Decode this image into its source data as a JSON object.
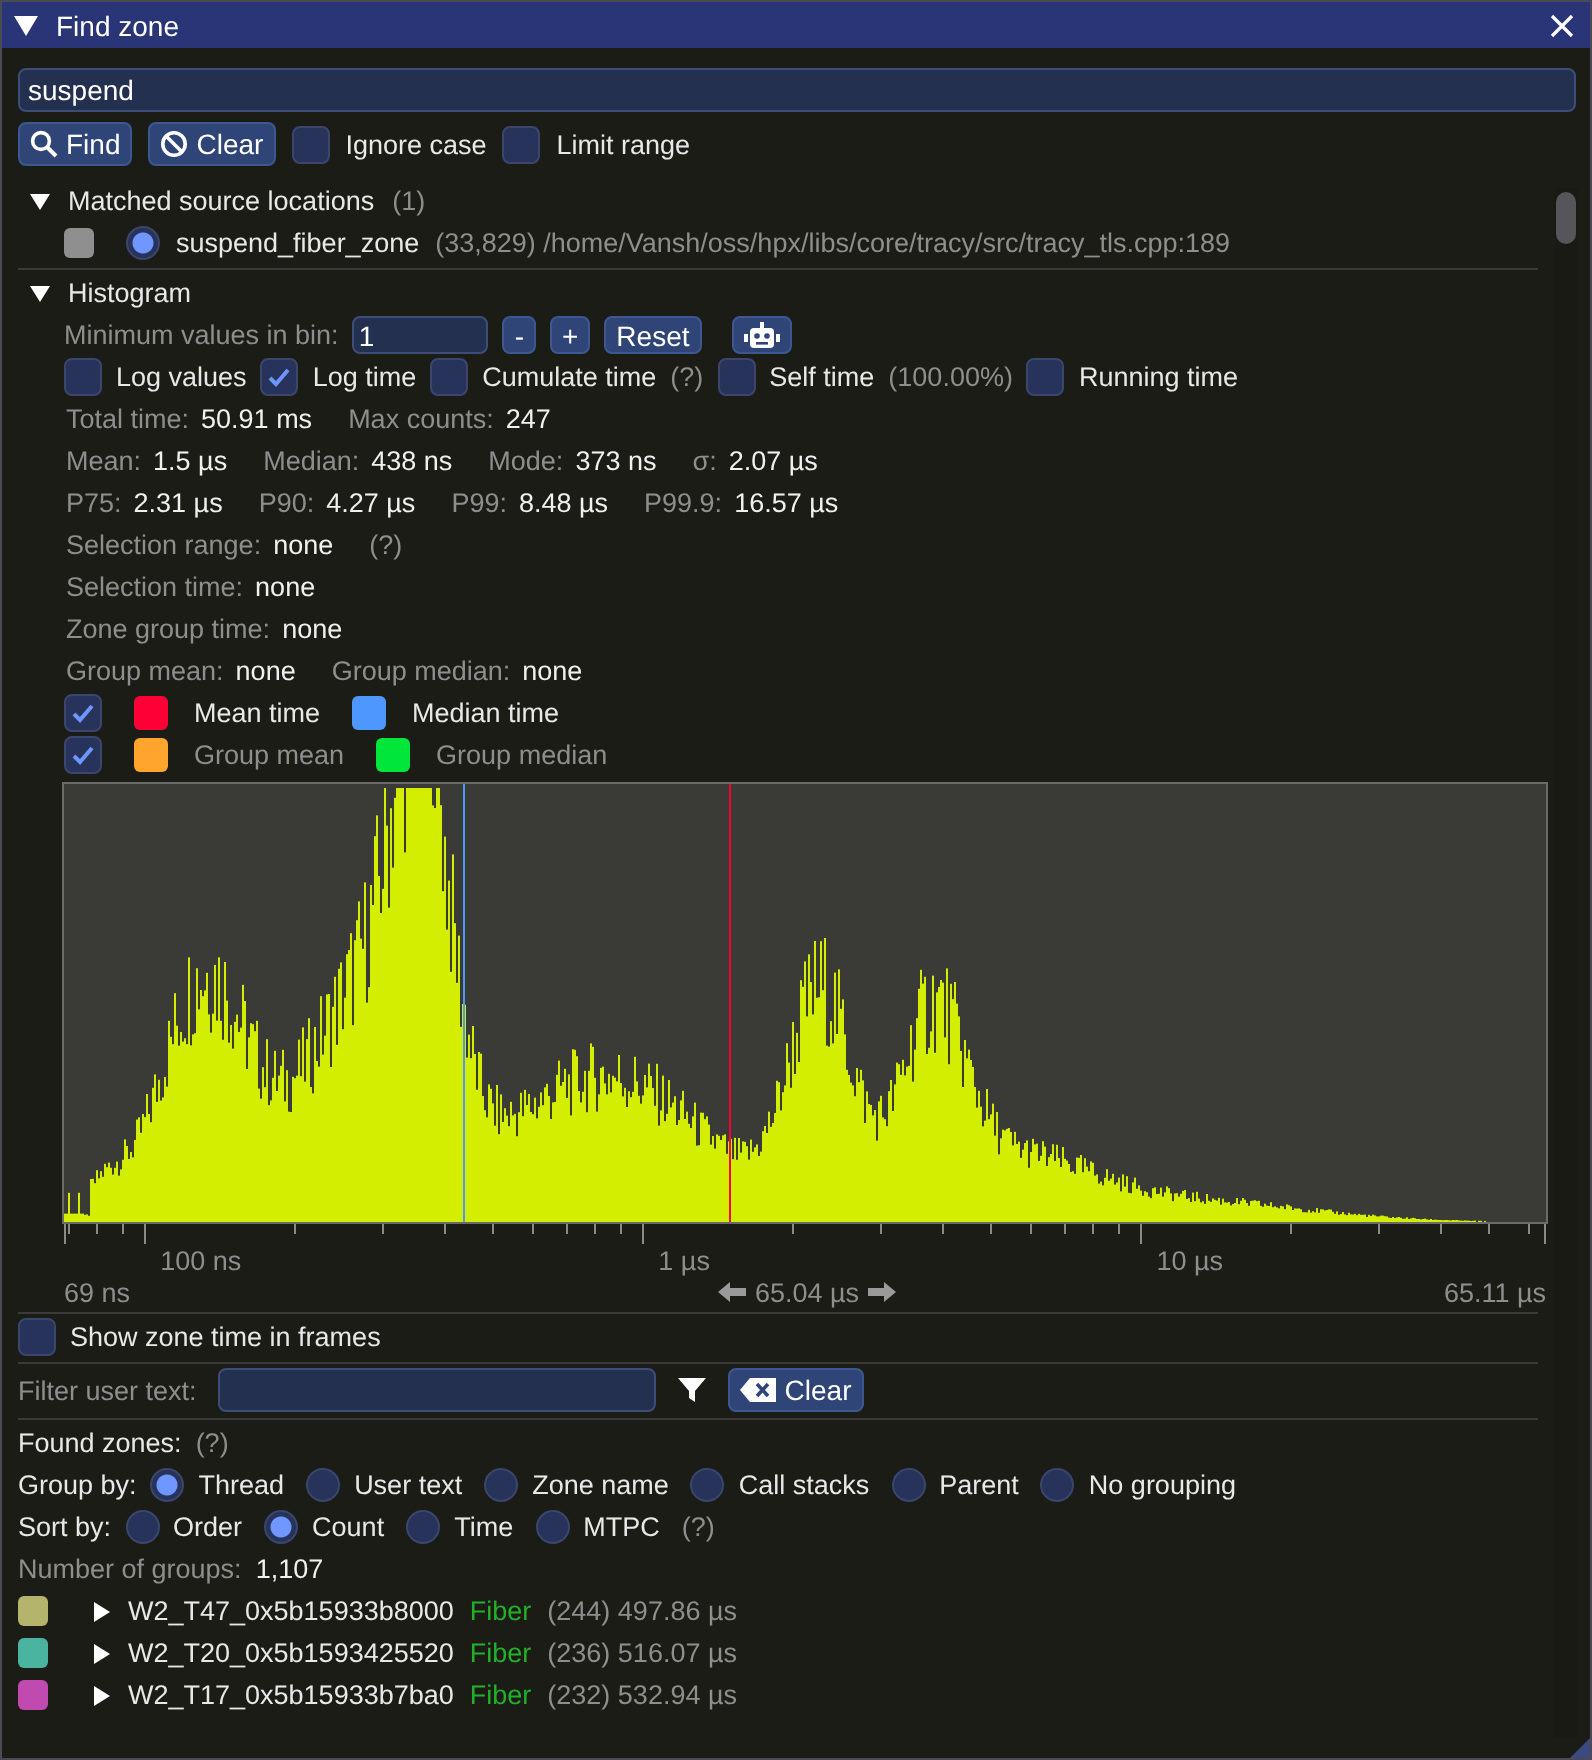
{
  "window": {
    "title": "Find zone"
  },
  "search": {
    "value": "suspend"
  },
  "search_buttons": [
    {
      "label": "Find"
    },
    {
      "label": "Clear"
    }
  ],
  "search_options": [
    {
      "label": "Ignore case",
      "checked": false
    },
    {
      "label": "Limit range",
      "checked": false
    }
  ],
  "matched_sources": {
    "title": "Matched source locations",
    "count": "(1)",
    "expanded": true,
    "items": [
      {
        "checked": false,
        "selected": true,
        "name": "suspend_fiber_zone",
        "count": "(33,829)",
        "path": "/home/Vansh/oss/hpx/libs/core/tracy/src/tracy_tls.cpp:189"
      }
    ]
  },
  "histogram": {
    "title": "Histogram",
    "expanded": true,
    "min_bin": {
      "label": "Minimum values in bin:",
      "value": "1",
      "buttons": [
        "-",
        "+",
        "Reset"
      ]
    },
    "toggles": [
      {
        "label": "Log values",
        "checked": false
      },
      {
        "label": "Log time",
        "checked": true
      },
      {
        "label": "Cumulate time",
        "checked": false,
        "note": "(?)"
      },
      {
        "label": "Self time",
        "checked": false,
        "note": "(100.00%)"
      },
      {
        "label": "Running time",
        "checked": false
      }
    ],
    "stats": [
      [
        {
          "label": "Total time:",
          "value": "50.91 ms"
        },
        {
          "label": "Max counts:",
          "value": "247"
        }
      ],
      [
        {
          "label": "Mean:",
          "value": "1.5 µs"
        },
        {
          "label": "Median:",
          "value": "438 ns"
        },
        {
          "label": "Mode:",
          "value": "373 ns"
        },
        {
          "label": "σ:",
          "value": "2.07 µs"
        }
      ],
      [
        {
          "label": "P75:",
          "value": "2.31 µs"
        },
        {
          "label": "P90:",
          "value": "4.27 µs"
        },
        {
          "label": "P99:",
          "value": "8.48 µs"
        },
        {
          "label": "P99.9:",
          "value": "16.57 µs"
        }
      ],
      [
        {
          "label": "Selection range:",
          "value": "none",
          "note": "(?)"
        }
      ],
      [
        {
          "label": "Selection time:",
          "value": "none"
        }
      ],
      [
        {
          "label": "Zone group time:",
          "value": "none"
        }
      ],
      [
        {
          "label": "Group mean:",
          "value": "none"
        },
        {
          "label": "Group median:",
          "value": "none"
        }
      ]
    ],
    "legend": [
      {
        "checked": true,
        "items": [
          {
            "label": "Mean time",
            "color": "#ff0036",
            "disabled": false
          },
          {
            "label": "Median time",
            "color": "#4e97ff",
            "disabled": false
          }
        ]
      },
      {
        "checked": true,
        "items": [
          {
            "label": "Group mean",
            "color": "#ffa42d",
            "disabled": true
          },
          {
            "label": "Group median",
            "color": "#00e63b",
            "disabled": true
          }
        ]
      }
    ],
    "axis": {
      "ticks": [
        "100 ns",
        "1 µs",
        "10 µs"
      ],
      "min": "69 ns",
      "range": "65.04 µs",
      "max": "65.11 µs"
    }
  },
  "show_frames": {
    "label": "Show zone time in frames",
    "checked": false
  },
  "filter": {
    "label": "Filter user text:",
    "clear": "Clear"
  },
  "found": {
    "title": "Found zones:",
    "note": "(?)",
    "group_by": {
      "label": "Group by:",
      "options": [
        {
          "label": "Thread",
          "selected": true
        },
        {
          "label": "User text",
          "selected": false
        },
        {
          "label": "Zone name",
          "selected": false
        },
        {
          "label": "Call stacks",
          "selected": false
        },
        {
          "label": "Parent",
          "selected": false
        },
        {
          "label": "No grouping",
          "selected": false
        }
      ]
    },
    "sort_by": {
      "label": "Sort by:",
      "options": [
        {
          "label": "Order",
          "selected": false
        },
        {
          "label": "Count",
          "selected": true
        },
        {
          "label": "Time",
          "selected": false
        },
        {
          "label": "MTPC",
          "selected": false
        }
      ],
      "note": "(?)"
    },
    "groups_count": {
      "label": "Number of groups:",
      "value": "1,107"
    },
    "rows": [
      {
        "color": "#b4b46c",
        "expanded": false,
        "name": "W2_T47_0x5b15933b8000",
        "tag": "Fiber",
        "count": "(244)",
        "time": "497.86 µs"
      },
      {
        "color": "#4bb4a0",
        "expanded": false,
        "name": "W2_T20_0x5b1593425520",
        "tag": "Fiber",
        "count": "(236)",
        "time": "516.07 µs"
      },
      {
        "color": "#c04ab0",
        "expanded": false,
        "name": "W2_T17_0x5b15933b7ba0",
        "tag": "Fiber",
        "count": "(232)",
        "time": "532.94 µs"
      }
    ]
  }
}
